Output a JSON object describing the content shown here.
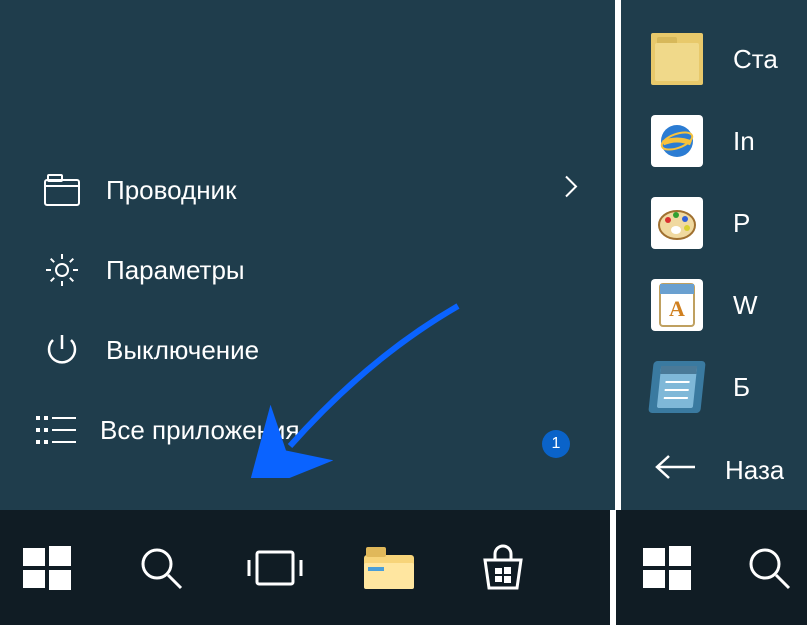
{
  "menu": {
    "explorer": "Проводник",
    "settings": "Параметры",
    "power": "Выключение",
    "all_apps": "Все приложения",
    "badge": "1"
  },
  "tiles": {
    "t0": "Ста",
    "t1": "In",
    "t2": "P",
    "t3": "W",
    "t4": "Б",
    "back": "Наза"
  },
  "colors": {
    "accent_blue": "#0a63c9",
    "bg": "#1f3d4c",
    "taskbar": "#101c24"
  }
}
